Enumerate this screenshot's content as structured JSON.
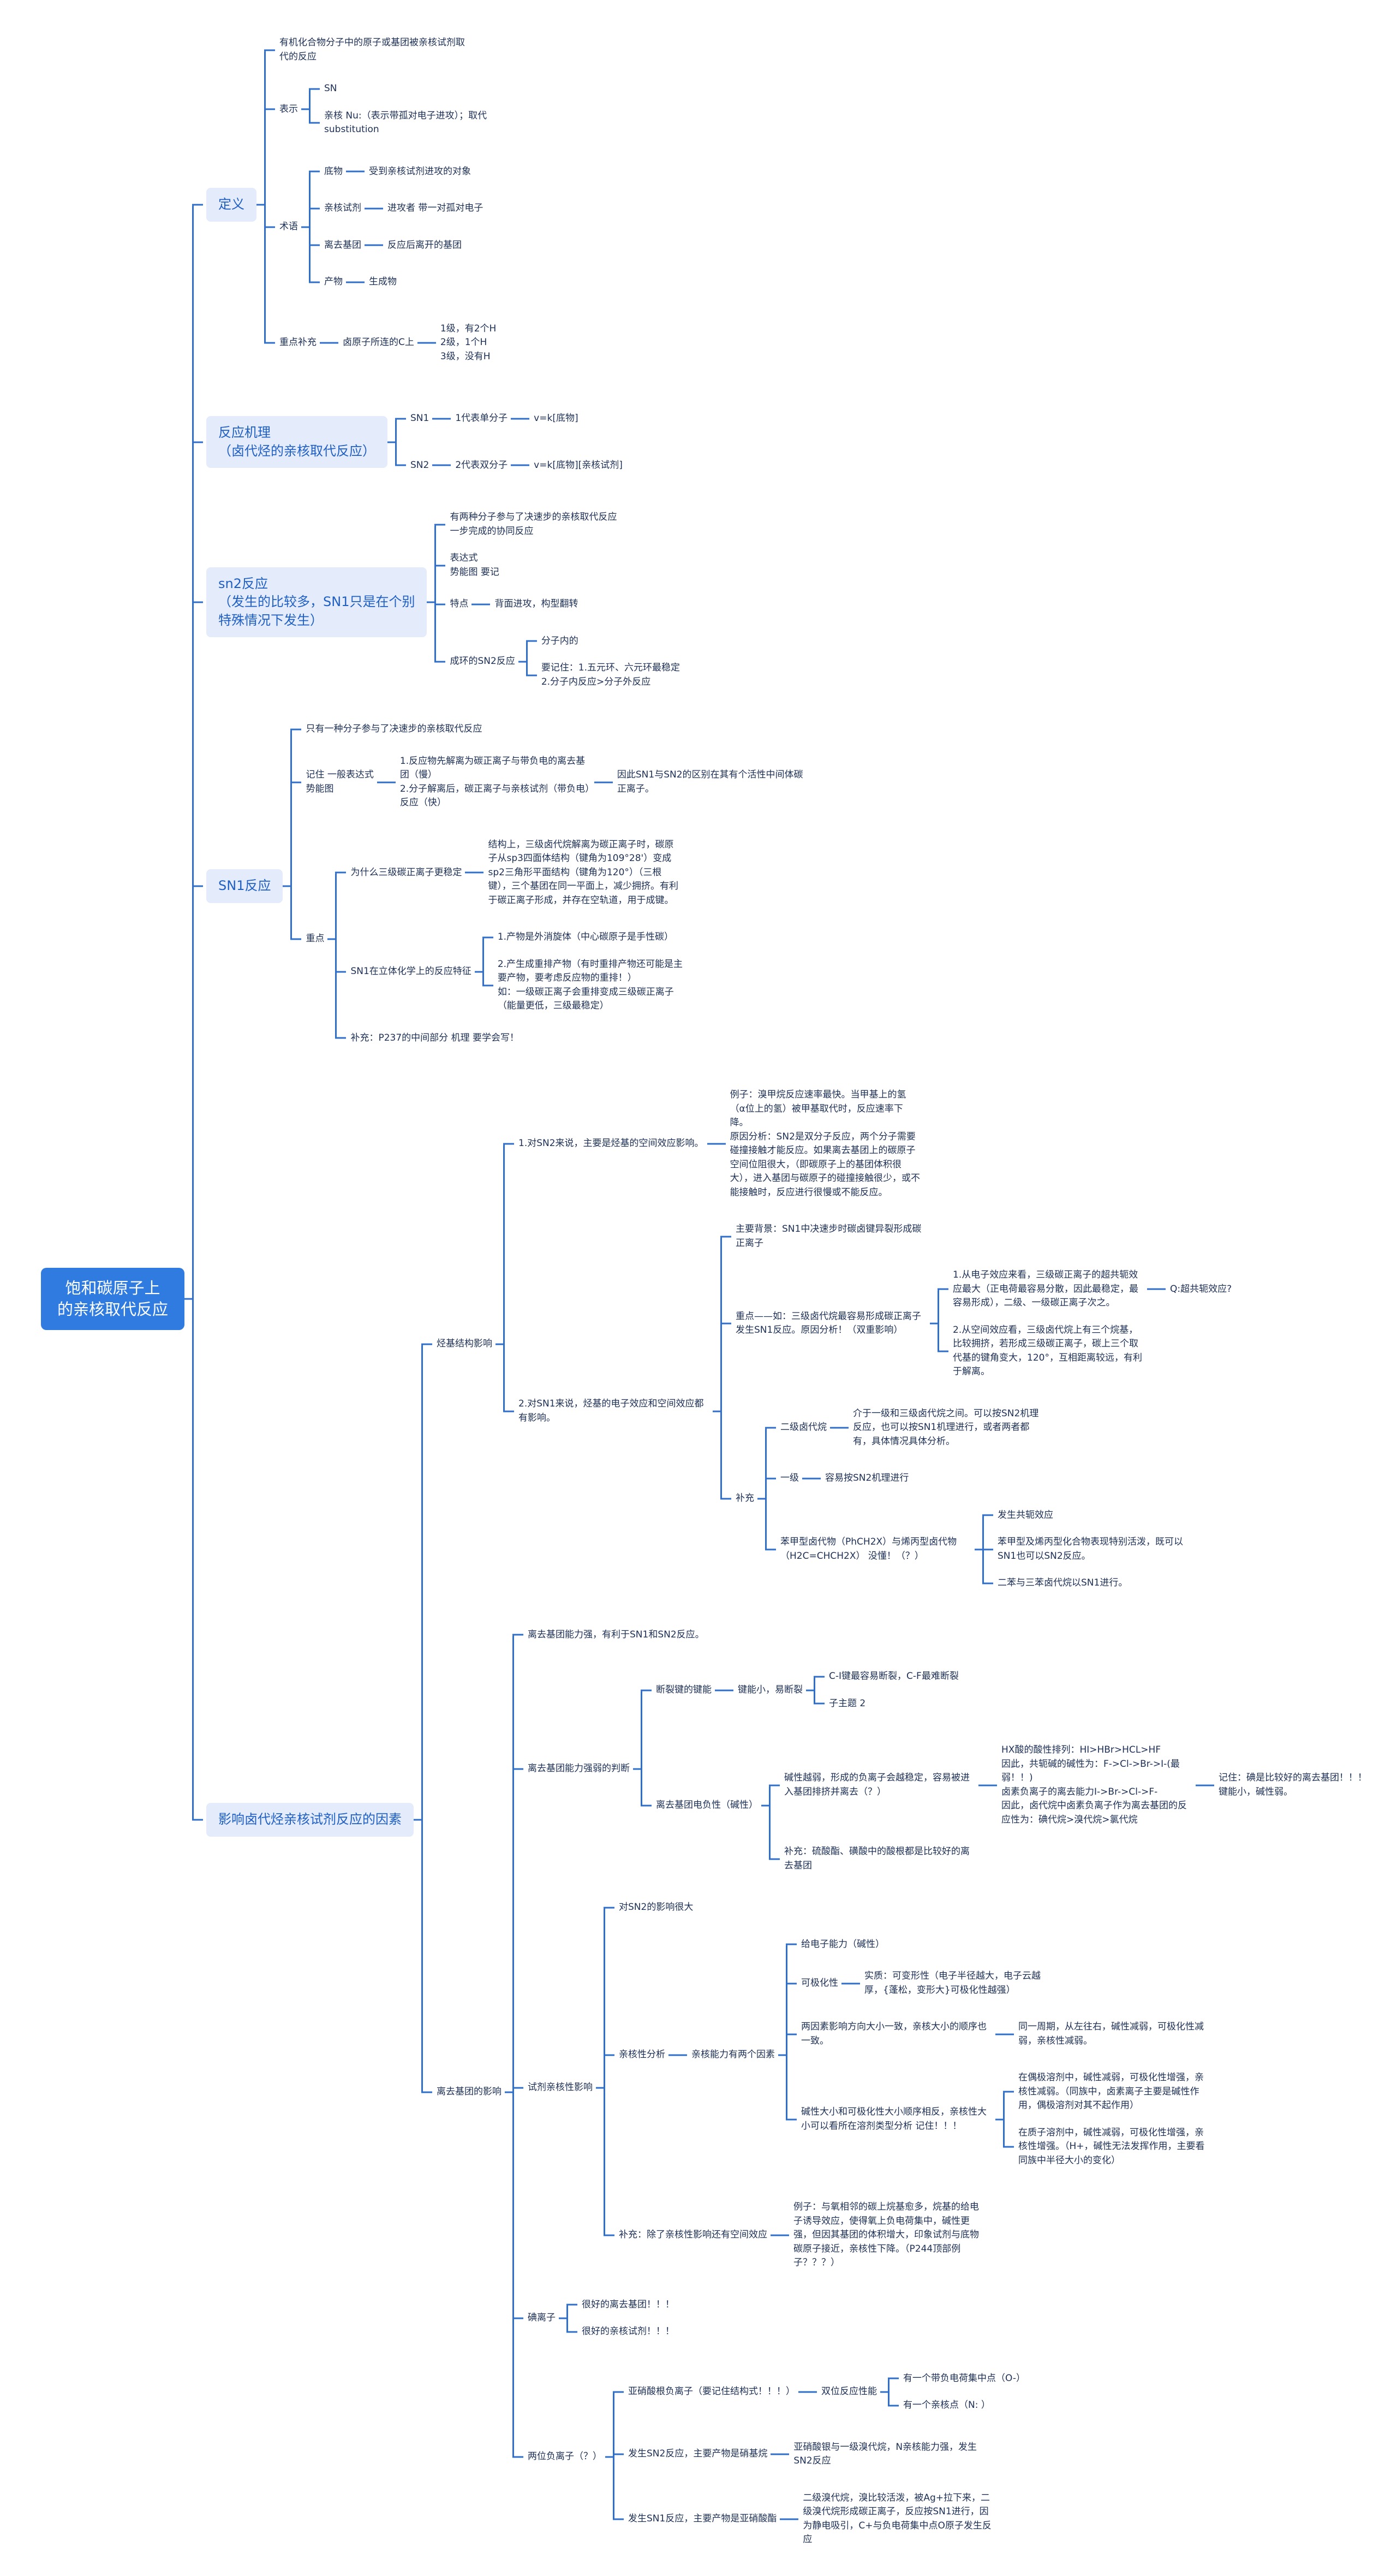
{
  "theme": {
    "root_color": "#2f7be0",
    "branch_bg": "#e4ecfb",
    "branch_text": "#1f5fc4",
    "line_color": "#2f6fca",
    "text_color": "#1c2f55"
  },
  "tree": {
    "t": "饱和碳原子上\n的亲核取代反应",
    "k": [
      {
        "t": "定义",
        "k": [
          {
            "t": "有机化合物分子中的原子或基团被亲核试剂取代的反应"
          },
          {
            "t": "表示",
            "k": [
              {
                "t": "SN"
              },
              {
                "t": "亲核 Nu:（表示带孤对电子进攻）；取代 substitution"
              }
            ]
          },
          {
            "t": "术语",
            "k": [
              {
                "t": "底物",
                "k": [
                  {
                    "t": "受到亲核试剂进攻的对象"
                  }
                ]
              },
              {
                "t": "亲核试剂",
                "k": [
                  {
                    "t": "进攻者 带一对孤对电子"
                  }
                ]
              },
              {
                "t": "离去基团",
                "k": [
                  {
                    "t": "反应后离开的基团"
                  }
                ]
              },
              {
                "t": "产物",
                "k": [
                  {
                    "t": "生成物"
                  }
                ]
              }
            ]
          },
          {
            "t": "重点补充",
            "k": [
              {
                "t": "卤原子所连的C上",
                "k": [
                  {
                    "t": "1级，有2个H\n2级，1个H\n3级，没有H"
                  }
                ]
              }
            ]
          }
        ]
      },
      {
        "t": "反应机理\n（卤代烃的亲核取代反应）",
        "k": [
          {
            "t": "SN1",
            "k": [
              {
                "t": "1代表单分子",
                "k": [
                  {
                    "t": "v=k[底物]"
                  }
                ]
              }
            ]
          },
          {
            "t": "SN2",
            "k": [
              {
                "t": "2代表双分子",
                "k": [
                  {
                    "t": "v=k[底物][亲核试剂]"
                  }
                ]
              }
            ]
          }
        ]
      },
      {
        "t": "sn2反应\n（发生的比较多，SN1只是在个别\n特殊情况下发生）",
        "k": [
          {
            "t": "有两种分子参与了决速步的亲核取代反应\n一步完成的协同反应"
          },
          {
            "t": "表达式\n势能图 要记"
          },
          {
            "t": "特点",
            "k": [
              {
                "t": "背面进攻，构型翻转"
              }
            ]
          },
          {
            "t": "成环的SN2反应",
            "k": [
              {
                "t": "分子内的"
              },
              {
                "t": "要记住：1.五元环、六元环最稳定\n2.分子内反应>分子外反应"
              }
            ]
          }
        ]
      },
      {
        "t": "SN1反应",
        "k": [
          {
            "t": "只有一种分子参与了决速步的亲核取代反应"
          },
          {
            "t": "记住 一般表达式\n势能图",
            "k": [
              {
                "t": "1.反应物先解离为碳正离子与带负电的离去基团（慢）\n2.分子解离后，碳正离子与亲核试剂（带负电）反应（快）",
                "k": [
                  {
                    "t": "因此SN1与SN2的区别在其有个活性中间体碳正离子。"
                  }
                ]
              }
            ]
          },
          {
            "t": "重点",
            "k": [
              {
                "t": "为什么三级碳正离子更稳定",
                "k": [
                  {
                    "t": "结构上，三级卤代烷解离为碳正离子时，碳原子从sp3四面体结构（键角为109°28'）变成sp2三角形平面结构（键角为120°）（三根键），三个基团在同一平面上，减少拥挤。有利于碳正离子形成，并存在空轨道，用于成键。"
                  }
                ]
              },
              {
                "t": "SN1在立体化学上的反应特征",
                "k": [
                  {
                    "t": "1.产物是外消旋体（中心碳原子是手性碳）"
                  },
                  {
                    "t": "2.产生成重排产物（有时重排产物还可能是主要产物，要考虑反应物的重排！）\n如：一级碳正离子会重排变成三级碳正离子（能量更低，三级最稳定）"
                  }
                ]
              },
              {
                "t": "补充：P237的中间部分 机理 要学会写！"
              }
            ]
          }
        ]
      },
      {
        "t": "影响卤代烃亲核试剂反应的因素",
        "k": [
          {
            "t": "烃基结构影响",
            "k": [
              {
                "t": "1.对SN2来说，主要是烃基的空间效应影响。",
                "k": [
                  {
                    "t": "例子：溴甲烷反应速率最快。当甲基上的氢（α位上的氢）被甲基取代时，反应速率下降。\n原因分析：SN2是双分子反应，两个分子需要碰撞接触才能反应。如果离去基团上的碳原子空间位阻很大，（即碳原子上的基团体积很大），进入基团与碳原子的碰撞接触很少，或不能接触时，反应进行很慢或不能反应。"
                  }
                ]
              },
              {
                "t": "2.对SN1来说，烃基的电子效应和空间效应都有影响。",
                "k": [
                  {
                    "t": "主要背景：SN1中决速步时碳卤键异裂形成碳正离子"
                  },
                  {
                    "t": "重点——如：三级卤代烷最容易形成碳正离子发生SN1反应。原因分析！（双重影响）",
                    "k": [
                      {
                        "t": "1.从电子效应来看，三级碳正离子的超共轭效应最大（正电荷最容易分散，因此最稳定，最容易形成），二级、一级碳正离子次之。",
                        "k": [
                          {
                            "t": "Q:超共轭效应?"
                          }
                        ]
                      },
                      {
                        "t": "2.从空间效应看，三级卤代烷上有三个烷基，比较拥挤，若形成三级碳正离子，碳上三个取代基的键角变大，120°，互相距离较远，有利于解离。"
                      }
                    ]
                  },
                  {
                    "t": "补充",
                    "k": [
                      {
                        "t": "二级卤代烷",
                        "k": [
                          {
                            "t": "介于一级和三级卤代烷之间。可以按SN2机理反应，也可以按SN1机理进行，或者两者都有，具体情况具体分析。"
                          }
                        ]
                      },
                      {
                        "t": "一级",
                        "k": [
                          {
                            "t": "容易按SN2机理进行"
                          }
                        ]
                      },
                      {
                        "t": "苯甲型卤代物（PhCH2X）与烯丙型卤代物（H2C=CHCH2X） 没懂！（？）",
                        "k": [
                          {
                            "t": "发生共轭效应"
                          },
                          {
                            "t": "苯甲型及烯丙型化合物表现特别活泼，既可以SN1也可以SN2反应。"
                          },
                          {
                            "t": "二苯与三苯卤代烷以SN1进行。"
                          }
                        ]
                      }
                    ]
                  }
                ]
              }
            ]
          },
          {
            "t": "离去基团的影响",
            "k": [
              {
                "t": "离去基团能力强，有利于SN1和SN2反应。"
              },
              {
                "t": "离去基团能力强弱的判断",
                "k": [
                  {
                    "t": "断裂键的键能",
                    "k": [
                      {
                        "t": "键能小，易断裂",
                        "k": [
                          {
                            "t": "C-I键最容易断裂，C-F最难断裂"
                          },
                          {
                            "t": "子主题 2"
                          }
                        ]
                      }
                    ]
                  },
                  {
                    "t": "离去基团电负性（碱性）",
                    "k": [
                      {
                        "t": "碱性越弱，形成的负离子会越稳定，容易被进入基团排挤并离去（？）",
                        "k": [
                          {
                            "t": "HX酸的酸性排列：HI>HBr>HCL>HF\n因此，共轭碱的碱性为：F->Cl->Br->I-(最弱！！)\n卤素负离子的离去能力I->Br->Cl->F-\n因此，卤代烷中卤素负离子作为离去基团的反应性为：碘代烷>溴代烷>氯代烷",
                            "k": [
                              {
                                "t": "记住：碘是比较好的离去基团！！！\n键能小，碱性弱。"
                              }
                            ]
                          }
                        ]
                      },
                      {
                        "t": "补充：硫酸酯、磺酸中的酸根都是比较好的离去基团"
                      }
                    ]
                  }
                ]
              },
              {
                "t": "试剂亲核性影响",
                "k": [
                  {
                    "t": "对SN2的影响很大"
                  },
                  {
                    "t": "亲核性分析",
                    "k": [
                      {
                        "t": "亲核能力有两个因素",
                        "k": [
                          {
                            "t": "给电子能力（碱性）"
                          },
                          {
                            "t": "可极化性",
                            "k": [
                              {
                                "t": "实质：可变形性（电子半径越大，电子云越厚，{蓬松，变形大}可极化性越强）"
                              }
                            ]
                          },
                          {
                            "t": "两因素影响方向大小一致，亲核大小的顺序也一致。",
                            "k": [
                              {
                                "t": "同一周期，从左往右，碱性减弱，可极化性减弱，亲核性减弱。"
                              }
                            ]
                          },
                          {
                            "t": "碱性大小和可极化性大小顺序相反，亲核性大小可以看所在溶剂类型分析 记住！！！",
                            "k": [
                              {
                                "t": "在偶极溶剂中，碱性减弱，可极化性增强，亲核性减弱。（同族中，卤素离子主要是碱性作用，偶极溶剂对其不起作用）"
                              },
                              {
                                "t": "在质子溶剂中，碱性减弱，可极化性增强，亲核性增强。（H+，碱性无法发挥作用，主要看同族中半径大小的变化）"
                              }
                            ]
                          }
                        ]
                      }
                    ]
                  },
                  {
                    "t": "补充：除了亲核性影响还有空间效应",
                    "k": [
                      {
                        "t": "例子：与氧相邻的碳上烷基愈多，烷基的给电子诱导效应，使得氧上负电荷集中，碱性更强，但因其基团的体积增大，印象试剂与底物碳原子接近，亲核性下降。（P244顶部例子？？？）"
                      }
                    ]
                  }
                ]
              },
              {
                "t": "碘离子",
                "k": [
                  {
                    "t": "很好的离去基团！！！"
                  },
                  {
                    "t": "很好的亲核试剂！！！"
                  }
                ]
              },
              {
                "t": "两位负离子（？）",
                "k": [
                  {
                    "t": "亚硝酸根负离子（要记住结构式！！！）",
                    "k": [
                      {
                        "t": "双位反应性能",
                        "k": [
                          {
                            "t": "有一个带负电荷集中点（O-）"
                          },
                          {
                            "t": "有一个亲核点（N: ）"
                          }
                        ]
                      }
                    ]
                  },
                  {
                    "t": "发生SN2反应，主要产物是硝基烷",
                    "k": [
                      {
                        "t": "亚硝酸银与一级溴代烷，N亲核能力强，发生SN2反应"
                      }
                    ]
                  },
                  {
                    "t": "发生SN1反应，主要产物是亚硝酸酯",
                    "k": [
                      {
                        "t": "二级溴代烷，溴比较活泼，被Ag+拉下来，二级溴代烷形成碳正离子，反应按SN1进行，因为静电吸引，C+与负电荷集中点O原子发生反应"
                      }
                    ]
                  }
                ]
              }
            ]
          }
        ]
      }
    ]
  }
}
